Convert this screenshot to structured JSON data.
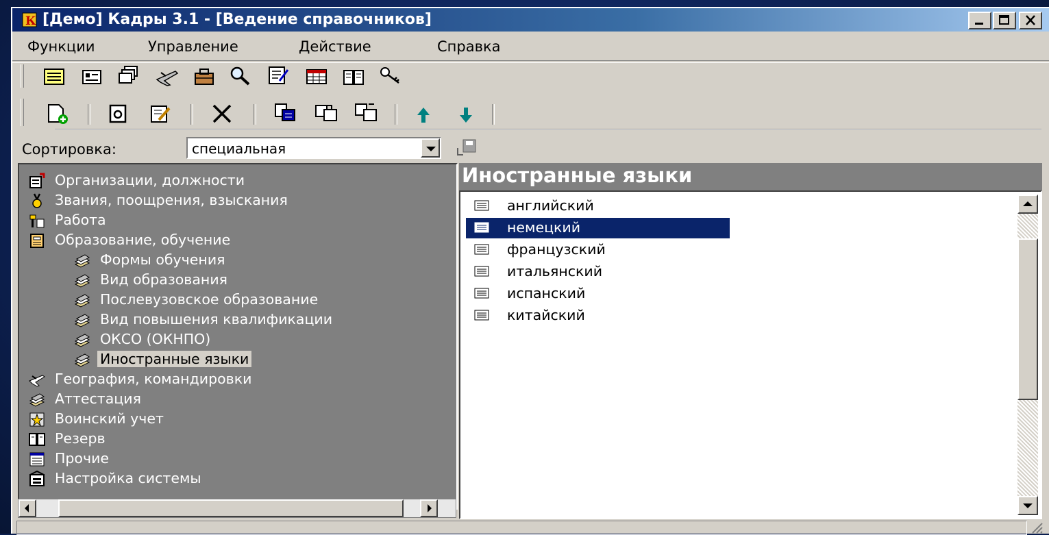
{
  "window": {
    "title": "[Демо] Кадры 3.1 - [Ведение справочников]",
    "controls": [
      "minimize-icon",
      "maximize-icon",
      "close-icon"
    ]
  },
  "menu": {
    "items": [
      "Функции",
      "Управление",
      "Действие",
      "Справка"
    ]
  },
  "toolbar1": {
    "icons": [
      "card-list-icon",
      "card-icon",
      "cards-stack-icon",
      "airplane-icon",
      "briefcase-icon",
      "search-icon",
      "document-edit-icon",
      "table-icon",
      "book-icon",
      "key-icon"
    ]
  },
  "toolbar2": {
    "icons": [
      "new-record-icon",
      "view-record-icon",
      "edit-record-icon",
      "delete-icon",
      "paste-icon",
      "copy-icon",
      "cut-icon",
      "move-up-icon",
      "move-down-icon"
    ]
  },
  "sort": {
    "label": "Сортировка:",
    "value": "специальная"
  },
  "tree": {
    "items": [
      {
        "label": "Организации, должности",
        "icon": "organization-icon"
      },
      {
        "label": "Звания, поощрения, взыскания",
        "icon": "medal-icon"
      },
      {
        "label": "Работа",
        "icon": "work-icon"
      },
      {
        "label": "Образование, обучение",
        "icon": "education-icon"
      },
      {
        "label": "Формы обучения",
        "icon": "books-icon"
      },
      {
        "label": "Вид образования",
        "icon": "books-icon"
      },
      {
        "label": "Послевузовское образование",
        "icon": "books-icon"
      },
      {
        "label": "Вид повышения квалификации",
        "icon": "books-icon"
      },
      {
        "label": "ОКСО (ОКНПО)",
        "icon": "books-icon"
      },
      {
        "label": "Иностранные языки",
        "icon": "books-icon"
      },
      {
        "label": "География, командировки",
        "icon": "airplane-icon"
      },
      {
        "label": "Аттестация",
        "icon": "books-icon"
      },
      {
        "label": "Воинский учет",
        "icon": "star-icon"
      },
      {
        "label": "Резерв",
        "icon": "book-icon"
      },
      {
        "label": "Прочие",
        "icon": "list-icon"
      },
      {
        "label": "Настройка системы",
        "icon": "settings-icon"
      }
    ]
  },
  "content": {
    "title": "Иностранные языки",
    "items": [
      "английский",
      "немецкий",
      "французский",
      "итальянский",
      "испанский",
      "китайский"
    ],
    "selected": "немецкий"
  },
  "colors": {
    "selection": "#0a246a",
    "panel_bg": "#808080",
    "window_bg": "#d4d0c8"
  }
}
